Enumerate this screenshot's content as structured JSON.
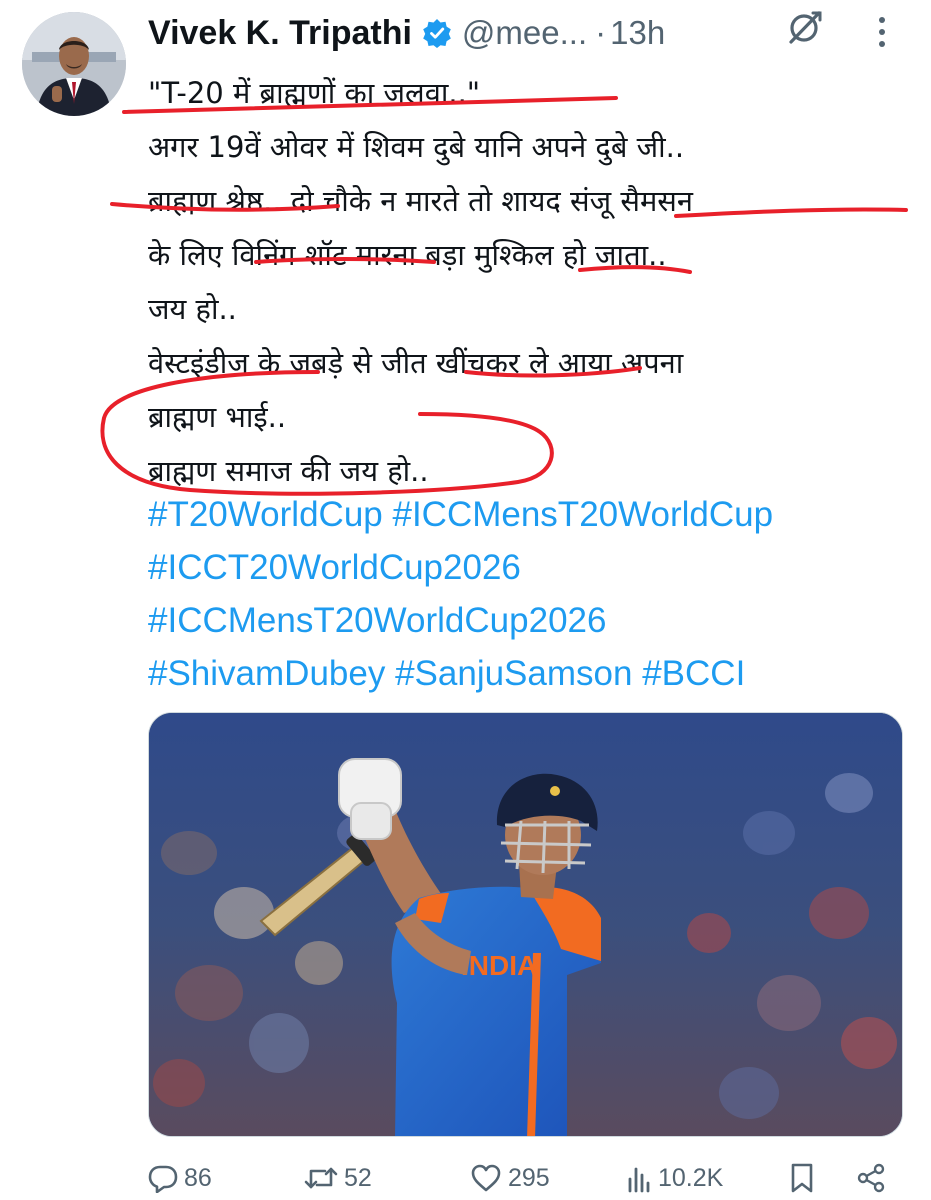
{
  "author": {
    "name": "Vivek K. Tripathi",
    "handle": "@mee...",
    "separator": "·",
    "time": "13h"
  },
  "tweet": {
    "lines": [
      "\"T-20 में ब्राह्मणों का जलवा..\"",
      " अगर 19वें ओवर में शिवम दुबे यानि अपने दुबे जी..",
      "ब्राह्मण श्रेष्ठ.. दो चौके न मारते तो शायद संजू सैमसन",
      "के लिए विनिंग शॉट मारना बड़ा मुश्किल हो जाता..",
      "जय हो..",
      "वेस्टइंडीज के जबड़े से जीत खींचकर ले आया अपना",
      "ब्राह्मण भाई..",
      "ब्राह्मण समाज की जय हो.."
    ],
    "hashtags": {
      "t20worldcup": "#T20WorldCup",
      "iccmenst20worldcup": "#ICCMensT20WorldCup",
      "icct20worldcup2026": "#ICCT20WorldCup2026",
      "iccmenst20worldcup2026": "#ICCMensT20WorldCup2026",
      "shivamdubey": "#ShivamDubey",
      "sanjusamson": "#SanjuSamson",
      "bcci": "#BCCI"
    }
  },
  "media": {
    "jersey_text": "INDIA"
  },
  "actions": {
    "replies": "86",
    "reposts": "52",
    "likes": "295",
    "views": "10.2K"
  },
  "icons": {
    "verified": "verified-badge-icon",
    "grok": "grok-icon",
    "more": "more-options-icon",
    "reply": "reply-icon",
    "repost": "repost-icon",
    "like": "heart-icon",
    "views": "views-icon",
    "bookmark": "bookmark-icon",
    "share": "share-icon"
  },
  "colors": {
    "hashtag": "#1d9bf0",
    "secondary_text": "#536471",
    "annotation": "#e8202a"
  }
}
